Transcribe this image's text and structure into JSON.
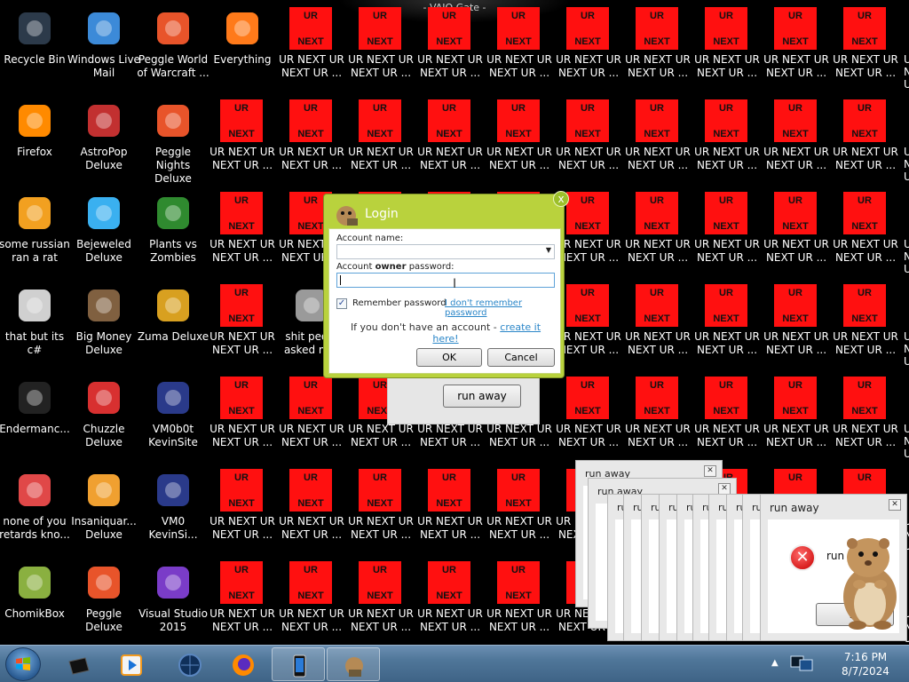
{
  "window_title": "- VAIO Gate -",
  "desktop": {
    "icons": [
      {
        "label": "Recycle Bin",
        "icon": "recycle-bin-icon"
      },
      {
        "label": "Windows Live Mail",
        "icon": "mail-icon"
      },
      {
        "label": "Peggle World of Warcraft ...",
        "icon": "peggle-icon"
      },
      {
        "label": "Everything",
        "icon": "search-icon"
      },
      {
        "label": "Firefox",
        "icon": "firefox-icon"
      },
      {
        "label": "AstroPop Deluxe",
        "icon": "astropop-icon"
      },
      {
        "label": "Peggle Nights Deluxe",
        "icon": "peggle-icon"
      },
      {
        "label": "some russian ran a rat",
        "icon": "e-app-icon"
      },
      {
        "label": "Bejeweled Deluxe",
        "icon": "gem-icon"
      },
      {
        "label": "Plants vs Zombies",
        "icon": "plant-icon"
      },
      {
        "label": "that but its c#",
        "icon": "shortcut-icon"
      },
      {
        "label": "Big Money Deluxe",
        "icon": "money-icon"
      },
      {
        "label": "Zuma Deluxe",
        "icon": "zuma-icon"
      },
      {
        "label": "shit peo... asked m...",
        "icon": "folder-icon"
      },
      {
        "label": "Endermanc...",
        "icon": "terminal-icon"
      },
      {
        "label": "Chuzzle Deluxe",
        "icon": "chuzzle-icon"
      },
      {
        "label": "VM0b0t KevinSite",
        "icon": "vm-icon"
      },
      {
        "label": "none of you retards kno...",
        "icon": "app-icon"
      },
      {
        "label": "Insaniquar... Deluxe",
        "icon": "fish-icon"
      },
      {
        "label": "VM0 KevinSi...",
        "icon": "vm-icon"
      },
      {
        "label": "ChomikBox",
        "icon": "chomikbox-icon"
      },
      {
        "label": "Peggle Deluxe",
        "icon": "peggle-icon"
      },
      {
        "label": "Visual Studio 2015",
        "icon": "visual-studio-icon"
      }
    ],
    "ur_tile": {
      "top": "UR",
      "bottom": "NEXT",
      "label_line1": "UR NEXT UR",
      "label_line2": "NEXT UR ..."
    }
  },
  "login": {
    "title": "Login",
    "account_name_label": "Account name:",
    "account_name_value": "",
    "password_label_prefix": "Account ",
    "password_label_bold": "owner",
    "password_label_suffix": " password:",
    "password_value": "",
    "remember_label": "Remember password",
    "remember_checked": true,
    "forgot_link": "I don't remember password",
    "signup_text": "If you don't have an account - ",
    "signup_link": "create it here!",
    "ok": "OK",
    "cancel": "Cancel",
    "close": "x"
  },
  "run_away": {
    "title": "run away",
    "message": "run",
    "button": "run away",
    "button_partial": "ru",
    "stack_title_partial": "ru"
  },
  "taskbar": {
    "time": "7:16 PM",
    "date": "8/7/2024",
    "tray_arrow": "▲"
  },
  "colors": {
    "ur_red": "#ff1010",
    "login_green": "#b9d23d",
    "taskbar": "#4f7699",
    "link": "#2a86c8"
  }
}
